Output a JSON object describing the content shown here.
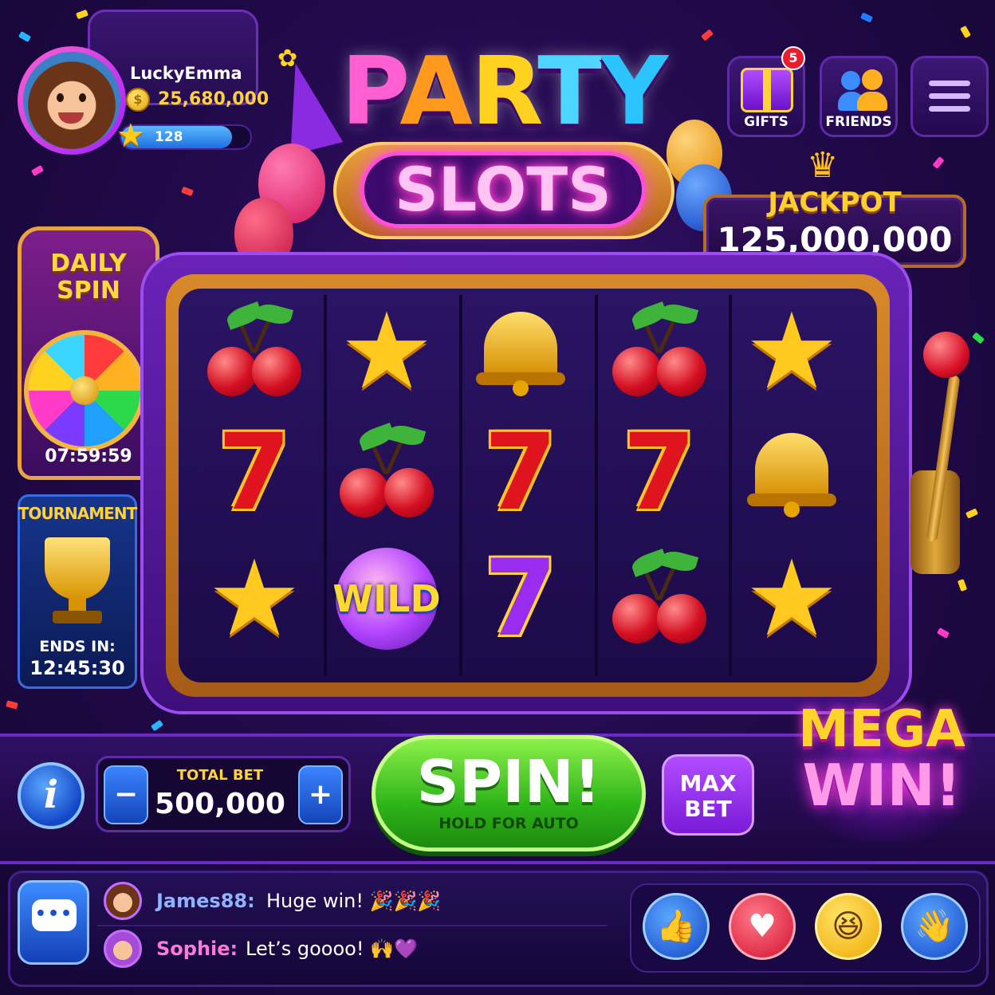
{
  "profile": {
    "username": "LuckyEmma",
    "coin_symbol": "$",
    "coins": "25,680,000",
    "level": "128",
    "xp_progress": 0.86
  },
  "logo": {
    "title_top": "PARTY",
    "title_bottom": "SLOTS"
  },
  "top_buttons": {
    "gifts_label": "GIFTS",
    "gifts_badge": "5",
    "friends_label": "FRIENDS"
  },
  "jackpot": {
    "label": "JACKPOT",
    "value": "125,000,000"
  },
  "daily_spin": {
    "title": "DAILY SPIN",
    "timer": "07:59:59"
  },
  "tournament": {
    "title": "TOURNAMENT",
    "ends_label": "ENDS IN:",
    "time": "12:45:30"
  },
  "reels": {
    "wild_label": "WILD",
    "columns": [
      [
        "cherry",
        "seven-red",
        "star"
      ],
      [
        "star",
        "cherry",
        "wild"
      ],
      [
        "bell",
        "seven-red",
        "seven-purple"
      ],
      [
        "cherry",
        "seven-red",
        "cherry"
      ],
      [
        "star",
        "bell",
        "star"
      ]
    ]
  },
  "controls": {
    "info_label": "i",
    "total_bet_label": "TOTAL BET",
    "total_bet_value": "500,000",
    "minus_label": "−",
    "plus_label": "+",
    "spin_label": "SPIN!",
    "spin_sub": "HOLD FOR AUTO",
    "max_bet_label": "MAX BET"
  },
  "mega_win": {
    "line1": "MEGA",
    "line2": "WIN!"
  },
  "chat": {
    "messages": [
      {
        "name": "James88:",
        "text": "Huge win! 🎉🎉🎉",
        "name_color": "#8fb4ff"
      },
      {
        "name": "Sophie:",
        "text": "Let’s goooo! 🙌💜",
        "name_color": "#ff7ad8"
      }
    ]
  },
  "reactions": [
    "thumbs-up-icon",
    "heart-icon",
    "laughing-face-icon",
    "waving-hand-icon"
  ],
  "colors": {
    "accent_gold": "#ffd23a",
    "spin_green": "#2fb51a",
    "brand_purple": "#6a22b8",
    "pink_neon": "#ff4fd8"
  }
}
